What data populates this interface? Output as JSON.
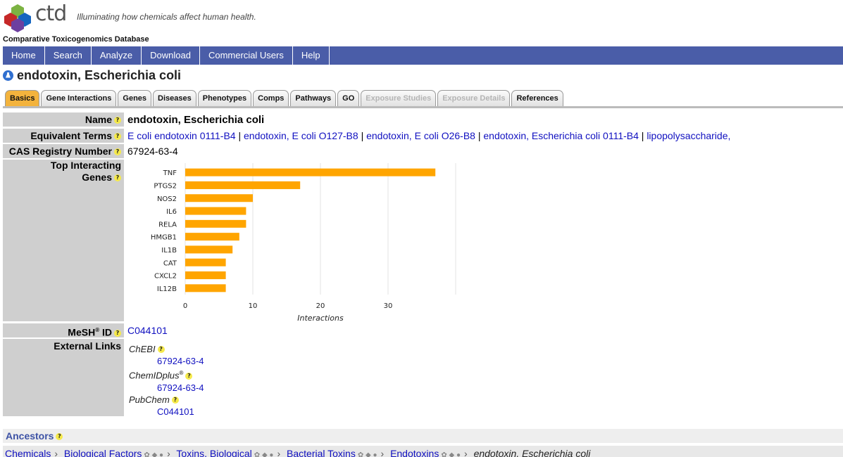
{
  "header": {
    "logo_text": "ctd",
    "tagline": "Illuminating how chemicals affect human health.",
    "site_name": "Comparative Toxicogenomics Database"
  },
  "nav": [
    "Home",
    "Search",
    "Analyze",
    "Download",
    "Commercial Users",
    "Help"
  ],
  "page": {
    "title": "endotoxin, Escherichia coli"
  },
  "tabs": [
    {
      "label": "Basics",
      "state": "active"
    },
    {
      "label": "Gene Interactions",
      "state": "normal"
    },
    {
      "label": "Genes",
      "state": "normal"
    },
    {
      "label": "Diseases",
      "state": "normal"
    },
    {
      "label": "Phenotypes",
      "state": "normal"
    },
    {
      "label": "Comps",
      "state": "normal"
    },
    {
      "label": "Pathways",
      "state": "normal"
    },
    {
      "label": "GO",
      "state": "normal"
    },
    {
      "label": "Exposure Studies",
      "state": "disabled"
    },
    {
      "label": "Exposure Details",
      "state": "disabled"
    },
    {
      "label": "References",
      "state": "normal"
    }
  ],
  "fields": {
    "name_label": "Name",
    "name_value": "endotoxin, Escherichia coli",
    "equiv_label": "Equivalent Terms",
    "equiv_terms": [
      "E coli endotoxin 0111-B4",
      "endotoxin, E coli O127-B8",
      "endotoxin, E coli O26-B8",
      "endotoxin, Escherichia coli 0111-B4",
      "lipopolysaccharide,"
    ],
    "equiv_sep": "|",
    "cas_label": "CAS Registry Number",
    "cas_value": "67924-63-4",
    "top_genes_label_1": "Top Interacting",
    "top_genes_label_2": "Genes",
    "mesh_label": "MeSH",
    "mesh_sup": "®",
    "mesh_label_suffix": " ID",
    "mesh_value": "C044101",
    "ext_label": "External Links",
    "ext_links": [
      {
        "name": "ChEBI",
        "sup": "",
        "value": "67924-63-4"
      },
      {
        "name": "ChemIDplus",
        "sup": "®",
        "value": "67924-63-4"
      },
      {
        "name": "PubChem",
        "sup": "",
        "value": "C044101"
      }
    ]
  },
  "help_glyph": "?",
  "chart_data": {
    "type": "bar",
    "orientation": "horizontal",
    "categories": [
      "TNF",
      "PTGS2",
      "NOS2",
      "IL6",
      "RELA",
      "HMGB1",
      "IL1B",
      "CAT",
      "CXCL2",
      "IL12B"
    ],
    "values": [
      37,
      17,
      10,
      9,
      9,
      8,
      7,
      6,
      6,
      6
    ],
    "xlabel": "Interactions",
    "xticks": [
      0,
      10,
      20,
      30
    ],
    "xlim": [
      0,
      40
    ],
    "grid": true,
    "bar_color": "#ffa500"
  },
  "ancestors": {
    "title": "Ancestors",
    "path": [
      "Chemicals",
      "Biological Factors",
      "Toxins, Biological",
      "Bacterial Toxins",
      "Endotoxins"
    ],
    "current": "endotoxin, Escherichia coli",
    "separator": "›"
  },
  "colors": {
    "nav_bg": "#4a5da8",
    "active_tab": "#f3b33d",
    "label_bg": "#cfcfcf",
    "link": "#1010c0"
  }
}
